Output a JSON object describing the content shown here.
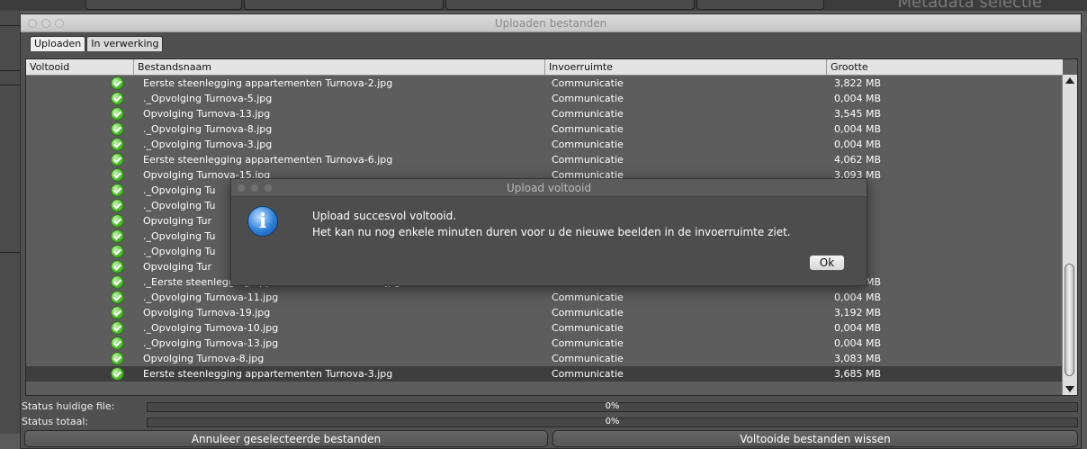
{
  "window": {
    "title": "Uploaden bestanden"
  },
  "background": {
    "title": "Metadata selectie"
  },
  "tabs": [
    {
      "label": "Uploaden",
      "active": true
    },
    {
      "label": "In verwerking",
      "active": false
    }
  ],
  "table": {
    "columns": [
      "Voltooid",
      "Bestandsnaam",
      "Invoerruimte",
      "Grootte"
    ],
    "rows": [
      {
        "name": "Eerste steenlegging appartementen Turnova-2.jpg",
        "space": "Communicatie",
        "size": "3,822 MB"
      },
      {
        "name": "._Opvolging Turnova-5.jpg",
        "space": "Communicatie",
        "size": "0,004 MB"
      },
      {
        "name": "Opvolging Turnova-13.jpg",
        "space": "Communicatie",
        "size": "3,545 MB"
      },
      {
        "name": "._Opvolging Turnova-8.jpg",
        "space": "Communicatie",
        "size": "0,004 MB"
      },
      {
        "name": "._Opvolging Turnova-3.jpg",
        "space": "Communicatie",
        "size": "0,004 MB"
      },
      {
        "name": "Eerste steenlegging appartementen Turnova-6.jpg",
        "space": "Communicatie",
        "size": "4,062 MB"
      },
      {
        "name": "Opvolging Turnova-15.jpg",
        "space": "Communicatie",
        "size": "3,093 MB"
      },
      {
        "name": "._Opvolging Tu",
        "space": "",
        "size": "MB"
      },
      {
        "name": "._Opvolging Tu",
        "space": "",
        "size": "MB"
      },
      {
        "name": "Opvolging Tur",
        "space": "",
        "size": "MB"
      },
      {
        "name": "._Opvolging Tu",
        "space": "",
        "size": "MB"
      },
      {
        "name": "._Opvolging Tu",
        "space": "",
        "size": "MB"
      },
      {
        "name": "Opvolging Tur",
        "space": "",
        "size": "MB"
      },
      {
        "name": "._Eerste steenlegging appartementen Turnova-1.jpg",
        "space": "Communicatie",
        "size": "0,004 MB"
      },
      {
        "name": "._Opvolging Turnova-11.jpg",
        "space": "Communicatie",
        "size": "0,004 MB"
      },
      {
        "name": "Opvolging Turnova-19.jpg",
        "space": "Communicatie",
        "size": "3,192 MB"
      },
      {
        "name": "._Opvolging Turnova-10.jpg",
        "space": "Communicatie",
        "size": "0,004 MB"
      },
      {
        "name": "._Opvolging Turnova-13.jpg",
        "space": "Communicatie",
        "size": "0,004 MB"
      },
      {
        "name": "Opvolging Turnova-8.jpg",
        "space": "Communicatie",
        "size": "3,083 MB"
      },
      {
        "name": "Eerste steenlegging appartementen Turnova-3.jpg",
        "space": "Communicatie",
        "size": "3,685 MB",
        "selected": true
      }
    ]
  },
  "status": {
    "file_label": "Status huidige file:",
    "file_percent": "0%",
    "file_value": 0,
    "total_label": "Status totaal:",
    "total_percent": "0%",
    "total_value": 0
  },
  "buttons": {
    "cancel_selected": "Annuleer geselecteerde bestanden",
    "clear_completed": "Voltooide bestanden wissen"
  },
  "modal": {
    "title": "Upload voltooid",
    "line1": "Upload succesvol voltooid.",
    "line2": "Het kan nu nog enkele minuten duren voor u de nieuwe beelden in de invoerruimte ziet.",
    "ok_label": "Ok"
  },
  "colors": {
    "check_green": "#4fb82f",
    "info_blue": "#2e7fd8",
    "selected_row": "#3e3e3e"
  }
}
